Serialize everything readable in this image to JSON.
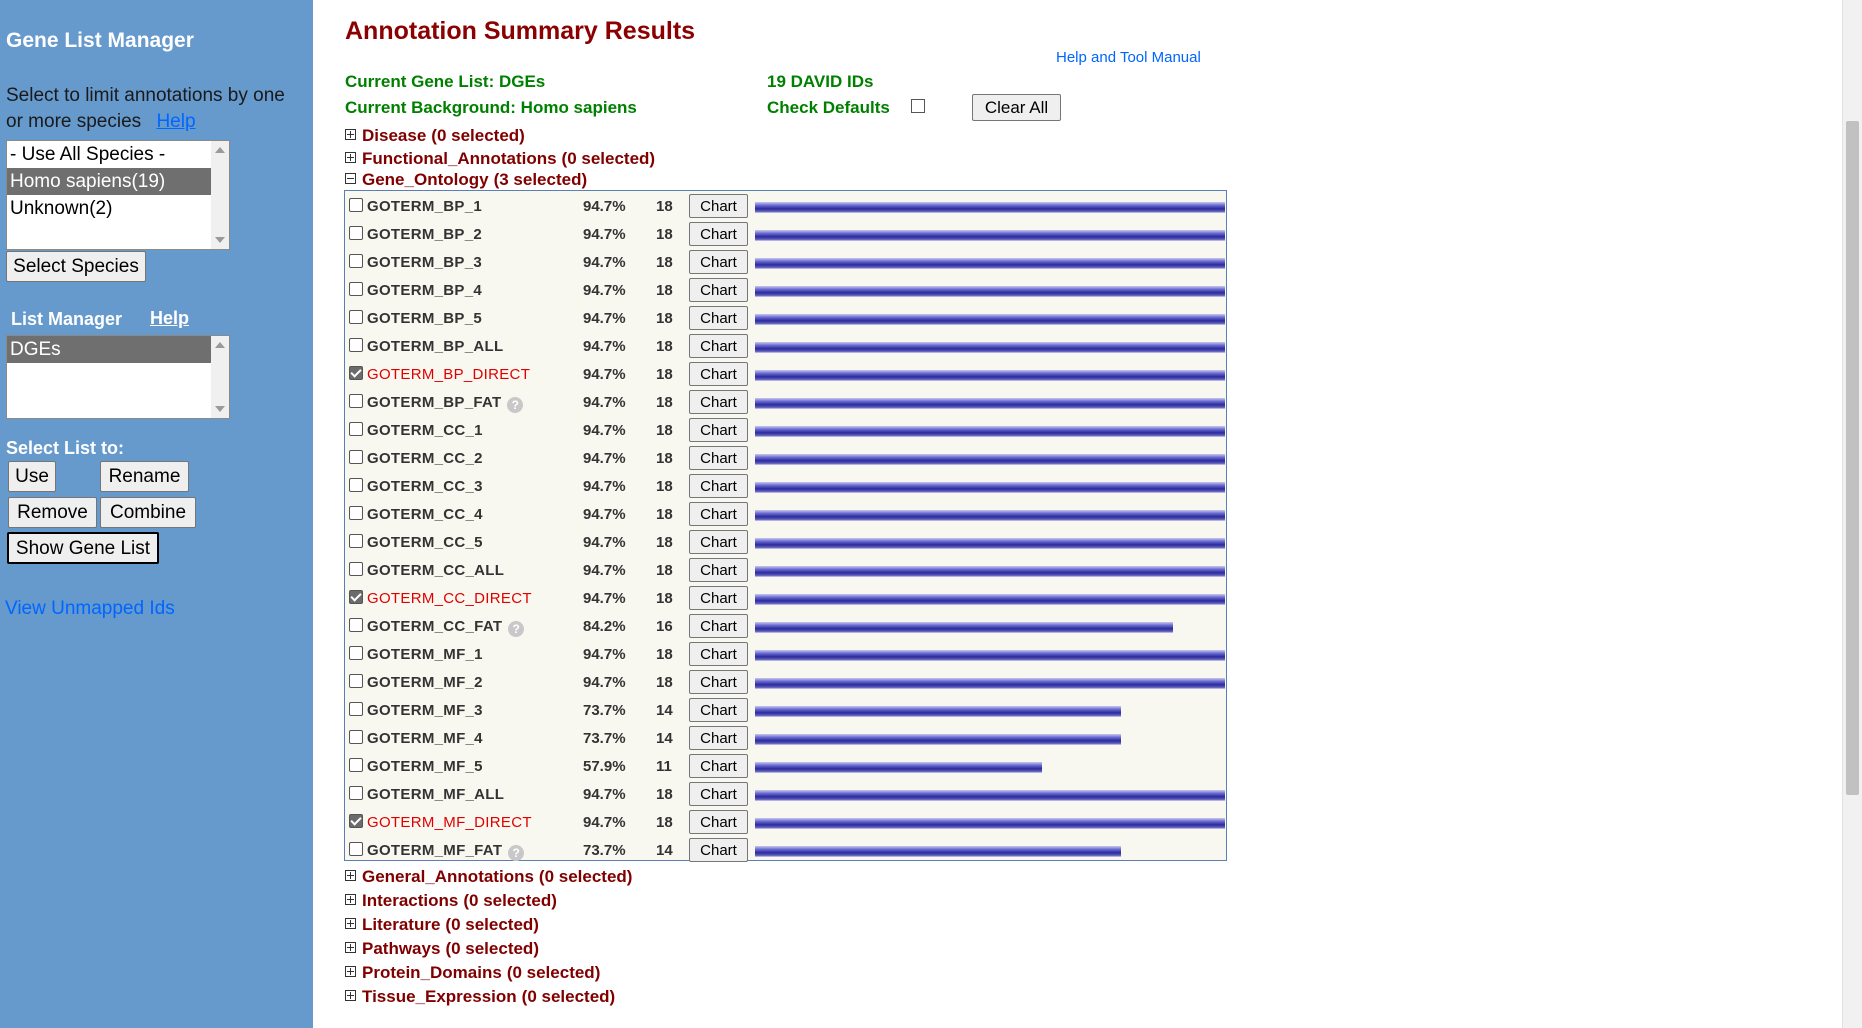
{
  "sidebar": {
    "title": "Gene List Manager",
    "species_desc": "Select to limit annotations by one or more species",
    "species_help": "Help",
    "species_options": [
      {
        "label": "- Use All Species -",
        "selected": false
      },
      {
        "label": "Homo sapiens(19)",
        "selected": true
      },
      {
        "label": "Unknown(2)",
        "selected": false
      }
    ],
    "select_species_button": "Select Species",
    "list_manager_label": "List Manager",
    "list_manager_help": "Help",
    "lists": [
      {
        "label": "DGEs",
        "selected": true
      }
    ],
    "select_list_label": "Select List to:",
    "use_button": "Use",
    "rename_button": "Rename",
    "remove_button": "Remove",
    "combine_button": "Combine",
    "show_gene_list_button": "Show Gene List",
    "view_unmapped_link": "View Unmapped Ids"
  },
  "main": {
    "title": "Annotation Summary Results",
    "help_manual_link": "Help and Tool Manual",
    "current_gene_list": "Current Gene List: DGEs",
    "current_background": "Current Background: Homo sapiens",
    "david_ids": "19 DAVID IDs",
    "check_defaults": "Check Defaults",
    "clear_all_button": "Clear All",
    "categories_top": [
      {
        "name": "Disease",
        "selected": "(0 selected)",
        "expanded": false
      },
      {
        "name": "Functional_Annotations",
        "selected": "(0 selected)",
        "expanded": false
      },
      {
        "name": "Gene_Ontology",
        "selected": "(3 selected)",
        "expanded": true
      }
    ],
    "go_terms": [
      {
        "name": "GOTERM_BP_1",
        "pct": "94.7%",
        "count": "18",
        "checked": false,
        "help": false,
        "fraction": 1.0
      },
      {
        "name": "GOTERM_BP_2",
        "pct": "94.7%",
        "count": "18",
        "checked": false,
        "help": false,
        "fraction": 1.0
      },
      {
        "name": "GOTERM_BP_3",
        "pct": "94.7%",
        "count": "18",
        "checked": false,
        "help": false,
        "fraction": 1.0
      },
      {
        "name": "GOTERM_BP_4",
        "pct": "94.7%",
        "count": "18",
        "checked": false,
        "help": false,
        "fraction": 1.0
      },
      {
        "name": "GOTERM_BP_5",
        "pct": "94.7%",
        "count": "18",
        "checked": false,
        "help": false,
        "fraction": 1.0
      },
      {
        "name": "GOTERM_BP_ALL",
        "pct": "94.7%",
        "count": "18",
        "checked": false,
        "help": false,
        "fraction": 1.0
      },
      {
        "name": "GOTERM_BP_DIRECT",
        "pct": "94.7%",
        "count": "18",
        "checked": true,
        "help": false,
        "fraction": 1.0
      },
      {
        "name": "GOTERM_BP_FAT",
        "pct": "94.7%",
        "count": "18",
        "checked": false,
        "help": true,
        "fraction": 1.0
      },
      {
        "name": "GOTERM_CC_1",
        "pct": "94.7%",
        "count": "18",
        "checked": false,
        "help": false,
        "fraction": 1.0
      },
      {
        "name": "GOTERM_CC_2",
        "pct": "94.7%",
        "count": "18",
        "checked": false,
        "help": false,
        "fraction": 1.0
      },
      {
        "name": "GOTERM_CC_3",
        "pct": "94.7%",
        "count": "18",
        "checked": false,
        "help": false,
        "fraction": 1.0
      },
      {
        "name": "GOTERM_CC_4",
        "pct": "94.7%",
        "count": "18",
        "checked": false,
        "help": false,
        "fraction": 1.0
      },
      {
        "name": "GOTERM_CC_5",
        "pct": "94.7%",
        "count": "18",
        "checked": false,
        "help": false,
        "fraction": 1.0
      },
      {
        "name": "GOTERM_CC_ALL",
        "pct": "94.7%",
        "count": "18",
        "checked": false,
        "help": false,
        "fraction": 1.0
      },
      {
        "name": "GOTERM_CC_DIRECT",
        "pct": "94.7%",
        "count": "18",
        "checked": true,
        "help": false,
        "fraction": 1.0
      },
      {
        "name": "GOTERM_CC_FAT",
        "pct": "84.2%",
        "count": "16",
        "checked": false,
        "help": true,
        "fraction": 0.889
      },
      {
        "name": "GOTERM_MF_1",
        "pct": "94.7%",
        "count": "18",
        "checked": false,
        "help": false,
        "fraction": 1.0
      },
      {
        "name": "GOTERM_MF_2",
        "pct": "94.7%",
        "count": "18",
        "checked": false,
        "help": false,
        "fraction": 1.0
      },
      {
        "name": "GOTERM_MF_3",
        "pct": "73.7%",
        "count": "14",
        "checked": false,
        "help": false,
        "fraction": 0.778
      },
      {
        "name": "GOTERM_MF_4",
        "pct": "73.7%",
        "count": "14",
        "checked": false,
        "help": false,
        "fraction": 0.778
      },
      {
        "name": "GOTERM_MF_5",
        "pct": "57.9%",
        "count": "11",
        "checked": false,
        "help": false,
        "fraction": 0.611
      },
      {
        "name": "GOTERM_MF_ALL",
        "pct": "94.7%",
        "count": "18",
        "checked": false,
        "help": false,
        "fraction": 1.0
      },
      {
        "name": "GOTERM_MF_DIRECT",
        "pct": "94.7%",
        "count": "18",
        "checked": true,
        "help": false,
        "fraction": 1.0
      },
      {
        "name": "GOTERM_MF_FAT",
        "pct": "73.7%",
        "count": "14",
        "checked": false,
        "help": true,
        "fraction": 0.778
      }
    ],
    "chart_button_label": "Chart",
    "help_icon_glyph": "?",
    "categories_bottom": [
      {
        "name": "General_Annotations",
        "selected": "(0 selected)"
      },
      {
        "name": "Interactions",
        "selected": "(0 selected)"
      },
      {
        "name": "Literature",
        "selected": "(0 selected)"
      },
      {
        "name": "Pathways",
        "selected": "(0 selected)"
      },
      {
        "name": "Protein_Domains",
        "selected": "(0 selected)"
      },
      {
        "name": "Tissue_Expression",
        "selected": "(0 selected)"
      }
    ]
  },
  "colors": {
    "sidebar_bg": "#6699cc",
    "title_color": "#8b0000",
    "green_text": "#008000",
    "checked_term": "#e00000",
    "bar_color": "#2b2b9e"
  }
}
